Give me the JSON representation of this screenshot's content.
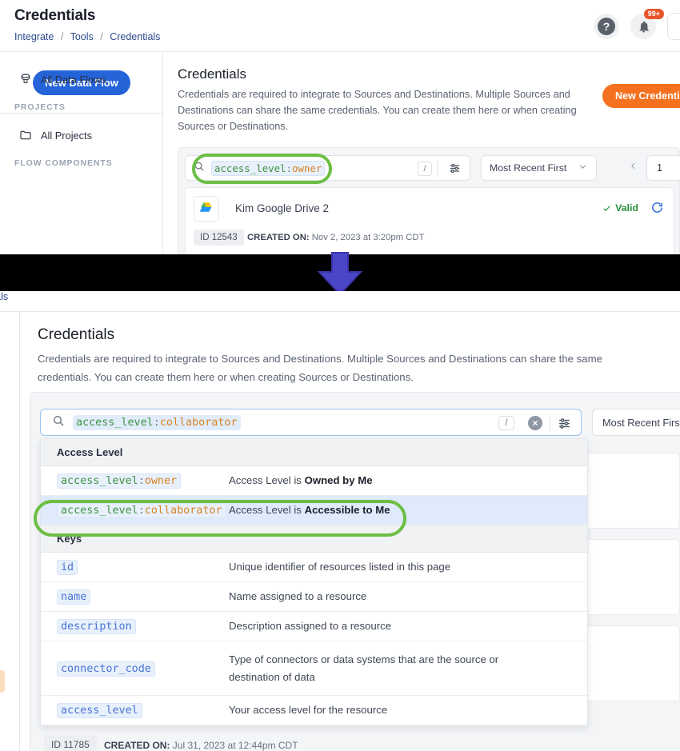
{
  "top": {
    "page_title": "Credentials",
    "breadcrumb": [
      "Integrate",
      "Tools",
      "Credentials"
    ],
    "sidebar": {
      "new_flow_label": "New Data Flow",
      "items": [
        {
          "label": "All Data Flows",
          "icon": "data-flow-icon"
        },
        {
          "label": "All Projects",
          "icon": "folder-icon"
        }
      ],
      "sections": [
        {
          "label": "PROJECTS"
        },
        {
          "label": "FLOW COMPONENTS"
        }
      ]
    },
    "section_title": "Credentials",
    "section_desc": "Credentials are required to integrate to Sources and Destinations. Multiple Sources and Destinations can share the same credentials. You can create them here or when creating Sources or Destinations.",
    "new_credential_label": "New Credential",
    "search": {
      "token_key": "access_level",
      "token_colon": ":",
      "token_value": "owner",
      "slash_hint": "/"
    },
    "sort_label": "Most Recent First",
    "page_number": "1",
    "card": {
      "name": "Kim Google Drive 2",
      "id_label": "ID 12543",
      "created_label": "CREATED ON:",
      "created_value": "Nov 2, 2023 at 3:20pm CDT",
      "status": "Valid"
    }
  },
  "bottom": {
    "breadcrumb_partial": "entials",
    "section_title": "Credentials",
    "section_desc": "Credentials are required to integrate to Sources and Destinations. Multiple Sources and Destinations can share the same credentials. You can create them here or when creating Sources or Destinations.",
    "search": {
      "token_key": "access_level",
      "token_colon": ":",
      "token_value": "collaborator",
      "slash_hint": "/"
    },
    "sort_label": "Most Recent First",
    "suggestions": [
      {
        "group": "Access Level",
        "rows": [
          {
            "token_key": "access_level",
            "token_colon": ":",
            "token_value": "owner",
            "desc_prefix": "Access Level is ",
            "desc_bold": "Owned by Me",
            "selected": false
          },
          {
            "token_key": "access_level",
            "token_colon": ":",
            "token_value": "collaborator",
            "desc_prefix": "Access Level is ",
            "desc_bold": "Accessible to Me",
            "selected": true
          }
        ]
      },
      {
        "group": "Keys",
        "rows": [
          {
            "key": "id",
            "desc": "Unique identifier of resources listed in this page"
          },
          {
            "key": "name",
            "desc": "Name assigned to a resource"
          },
          {
            "key": "description",
            "desc": "Description assigned to a resource"
          },
          {
            "key": "connector_code",
            "desc": "Type of connectors or data systems that are the source or destination of data"
          },
          {
            "key": "access_level",
            "desc": "Your access level for the resource"
          }
        ]
      }
    ],
    "card": {
      "id_label": "ID 11785",
      "created_label": "CREATED ON:",
      "created_value": "Jul 31, 2023 at 12:44pm CDT"
    }
  },
  "colors": {
    "primary_blue": "#2563d9",
    "accent_orange": "#f4711f",
    "valid_green": "#25913b",
    "highlight_green": "#6cbe45",
    "arrow_purple": "#4b45c8",
    "token_key_green": "#3f9142",
    "token_value_orange": "#d98324",
    "token_key_blue": "#4a74d6"
  },
  "icons": {
    "search": "search-icon",
    "help": "help-icon",
    "bell": "bell-icon",
    "bell_badge": "99+",
    "sliders": "sliders-icon",
    "chevron_down": "chevron-down-icon",
    "chevron_left": "chevron-left-icon",
    "check": "check-icon",
    "refresh": "refresh-icon",
    "clear": "clear-icon",
    "arrow_down": "arrow-down-icon"
  }
}
